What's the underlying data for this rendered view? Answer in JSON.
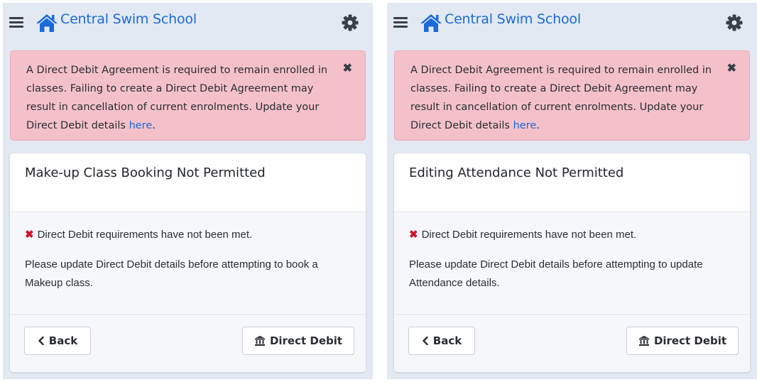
{
  "colors": {
    "brand_blue": "#1a6ad9",
    "alert_bg": "#f4c1cb",
    "error_red": "#d0112b",
    "page_bg": "#e3e9f3"
  },
  "left": {
    "header": {
      "school_name": "Central Swim School"
    },
    "alert": {
      "text": "A Direct Debit Agreement is required to remain enrolled in classes. Failing to create a Direct Debit Agreement may result in cancellation of current enrolments. Update your Direct Debit details ",
      "link": "here",
      "suffix": "."
    },
    "card": {
      "title": "Make-up Class Booking Not Permitted",
      "error": "Direct Debit requirements have not been met.",
      "message": "Please update Direct Debit details before attempting to book a Makeup class.",
      "back_label": "Back",
      "direct_debit_label": "Direct Debit"
    }
  },
  "right": {
    "header": {
      "school_name": "Central Swim School"
    },
    "alert": {
      "text": "A Direct Debit Agreement is required to remain enrolled in classes. Failing to create a Direct Debit Agreement may result in cancellation of current enrolments. Update your Direct Debit details ",
      "link": "here",
      "suffix": "."
    },
    "card": {
      "title": "Editing Attendance Not Permitted",
      "error": "Direct Debit requirements have not been met.",
      "message": "Please update Direct Debit details before attempting to update Attendance details.",
      "back_label": "Back",
      "direct_debit_label": "Direct Debit"
    }
  },
  "icons": {
    "menu": "hamburger-icon",
    "home": "home-icon",
    "settings": "gear-icon",
    "close": "close-icon",
    "error": "x-icon",
    "back": "chevron-left-icon",
    "bank": "bank-icon"
  }
}
